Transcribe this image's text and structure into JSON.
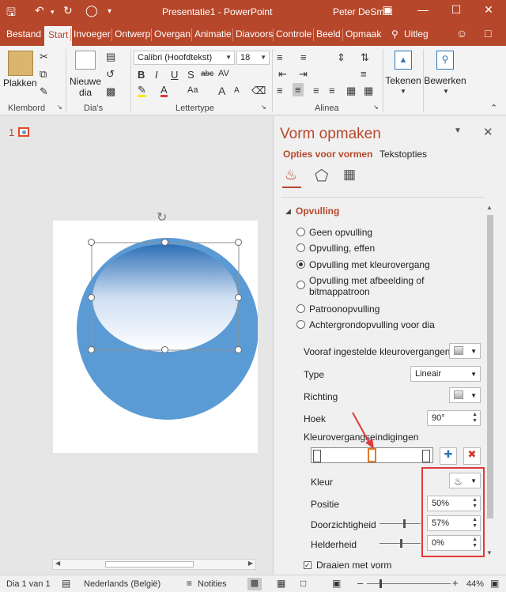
{
  "window": {
    "title": "Presentatie1 - PowerPoint",
    "user": "Peter DeSmet"
  },
  "qat": {
    "save_icon": "save-icon",
    "undo_icon": "undo-icon",
    "redo_icon": "redo-icon",
    "present_icon": "present-icon"
  },
  "tabs": [
    "Bestand",
    "Start",
    "Invoeger",
    "Ontwerp",
    "Overgan",
    "Animatie",
    "Diavoors",
    "Controle",
    "Beeld",
    "Opmaak"
  ],
  "tell_me": "Uitleg",
  "ribbon": {
    "clipboard": {
      "label": "Klembord",
      "paste": "Plakken"
    },
    "slides": {
      "label": "Dia's",
      "new_slide_1": "Nieuwe",
      "new_slide_2": "dia"
    },
    "font": {
      "label": "Lettertype",
      "font_name": "Calibri (Hoofdtekst)",
      "font_size": "18",
      "bold": "B",
      "italic": "I",
      "underline": "U",
      "shadow": "S",
      "strike": "abc",
      "spacing": "AV",
      "case": "Aa",
      "grow": "A",
      "shrink": "A",
      "font_color": "A"
    },
    "paragraph": {
      "label": "Alinea"
    },
    "drawing": {
      "label": "Tekenen"
    },
    "editing": {
      "label": "Bewerken"
    }
  },
  "slide_thumb_number": "1",
  "panel": {
    "title": "Vorm opmaken",
    "tab_shape": "Opties voor vormen",
    "tab_text": "Tekstopties",
    "section": "Opvulling",
    "fill_options": [
      {
        "label": "Geen opvulling",
        "checked": false
      },
      {
        "label": "Opvulling, effen",
        "checked": false
      },
      {
        "label": "Opvulling met kleurovergang",
        "checked": true
      },
      {
        "label": "Opvulling met afbeelding of",
        "label2": "bitmappatroon",
        "checked": false
      },
      {
        "label": "Patroonopvulling",
        "checked": false
      },
      {
        "label": "Achtergrondopvulling voor dia",
        "checked": false
      }
    ],
    "preset_label": "Vooraf ingestelde kleurovergangen",
    "type_label": "Type",
    "type_value": "Lineair",
    "direction_label": "Richting",
    "angle_label": "Hoek",
    "angle_value": "90°",
    "stops_label": "Kleurovergangseindigingen",
    "color_label": "Kleur",
    "position_label": "Positie",
    "position_value": "50%",
    "transparency_label": "Doorzichtigheid",
    "transparency_value": "57%",
    "brightness_label": "Helderheid",
    "brightness_value": "0%",
    "rotate_label": "Draaien met vorm",
    "position_level": 0.5,
    "transparency_level": 0.57,
    "brightness_level": 0.5
  },
  "status": {
    "slide": "Dia 1 van 1",
    "language": "Nederlands (België)",
    "notes": "Notities",
    "zoom": "44%"
  },
  "colors": {
    "accent": "#b7472a",
    "shape_blue": "#5b9bd5",
    "highlight_red": "#e03a3a"
  }
}
